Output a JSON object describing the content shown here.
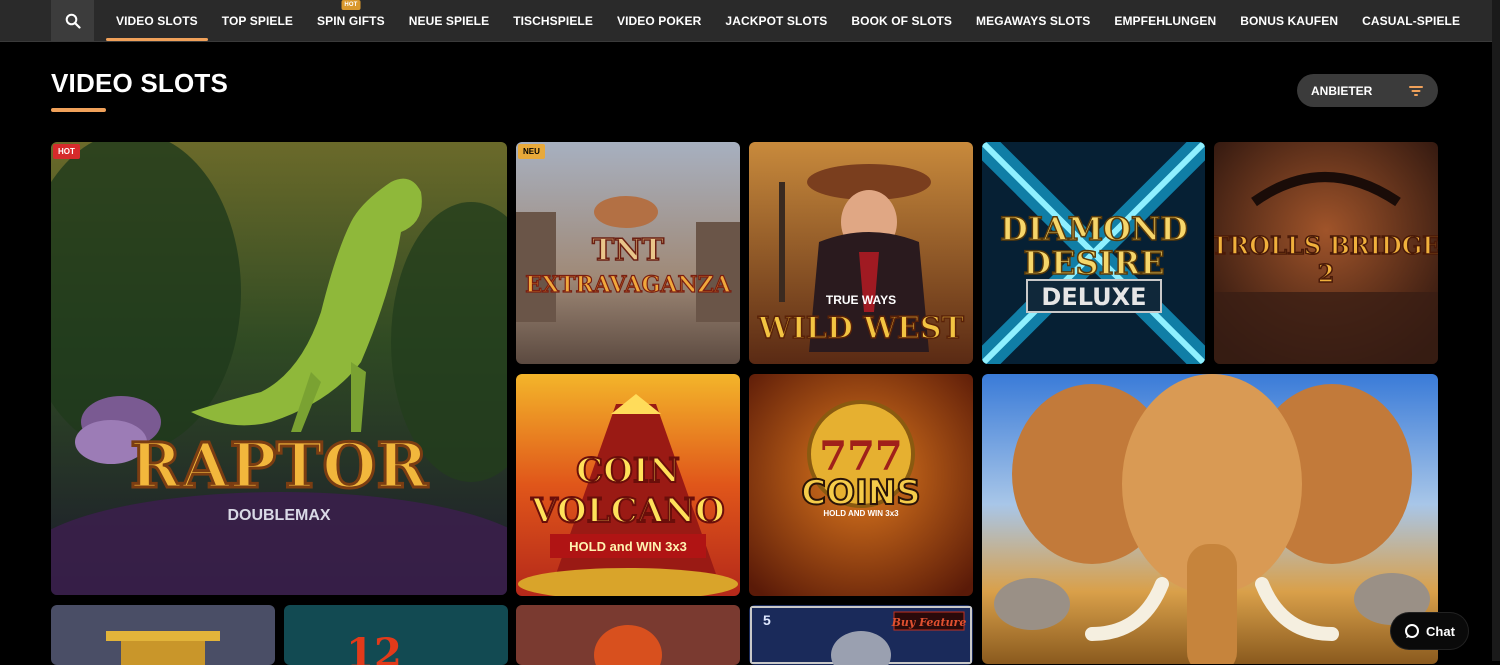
{
  "nav": {
    "items": [
      {
        "label": "VIDEO SLOTS",
        "active": true
      },
      {
        "label": "TOP SPIELE"
      },
      {
        "label": "SPIN GIFTS",
        "badge": "HOT"
      },
      {
        "label": "NEUE SPIELE"
      },
      {
        "label": "TISCHSPIELE"
      },
      {
        "label": "VIDEO POKER"
      },
      {
        "label": "JACKPOT SLOTS"
      },
      {
        "label": "BOOK OF SLOTS"
      },
      {
        "label": "MEGAWAYS SLOTS"
      },
      {
        "label": "EMPFEHLUNGEN"
      },
      {
        "label": "BONUS KAUFEN"
      },
      {
        "label": "CASUAL-SPIELE"
      }
    ],
    "search_icon": "search-icon"
  },
  "page": {
    "title": "VIDEO SLOTS",
    "filter_label": "ANBIETER",
    "accent": "#f0a15a"
  },
  "games": {
    "raptor": {
      "title": "RAPTOR",
      "subtitle": "DOUBLEMAX",
      "badge": "HOT"
    },
    "tnt": {
      "title_line1": "TNT",
      "title_line2": "EXTRAVAGANZA",
      "badge": "NEU"
    },
    "wildwest": {
      "tag": "TRUE WAYS",
      "title": "WILD WEST"
    },
    "diamond": {
      "line1": "DIAMOND",
      "line2": "DESIRE",
      "line3": "DELUXE"
    },
    "trolls": {
      "title": "TROLLS BRIDGE",
      "number": "2"
    },
    "volcano": {
      "line1": "COIN",
      "line2": "VOLCANO",
      "tag": "HOLD and WIN 3x3"
    },
    "coins": {
      "title": "COINS",
      "tag": "HOLD AND WIN 3x3",
      "number": "777"
    },
    "buyfeature": {
      "label": "Buy Feature",
      "num": "5"
    },
    "tile12": {
      "number": "12"
    }
  },
  "chat": {
    "label": "Chat"
  }
}
